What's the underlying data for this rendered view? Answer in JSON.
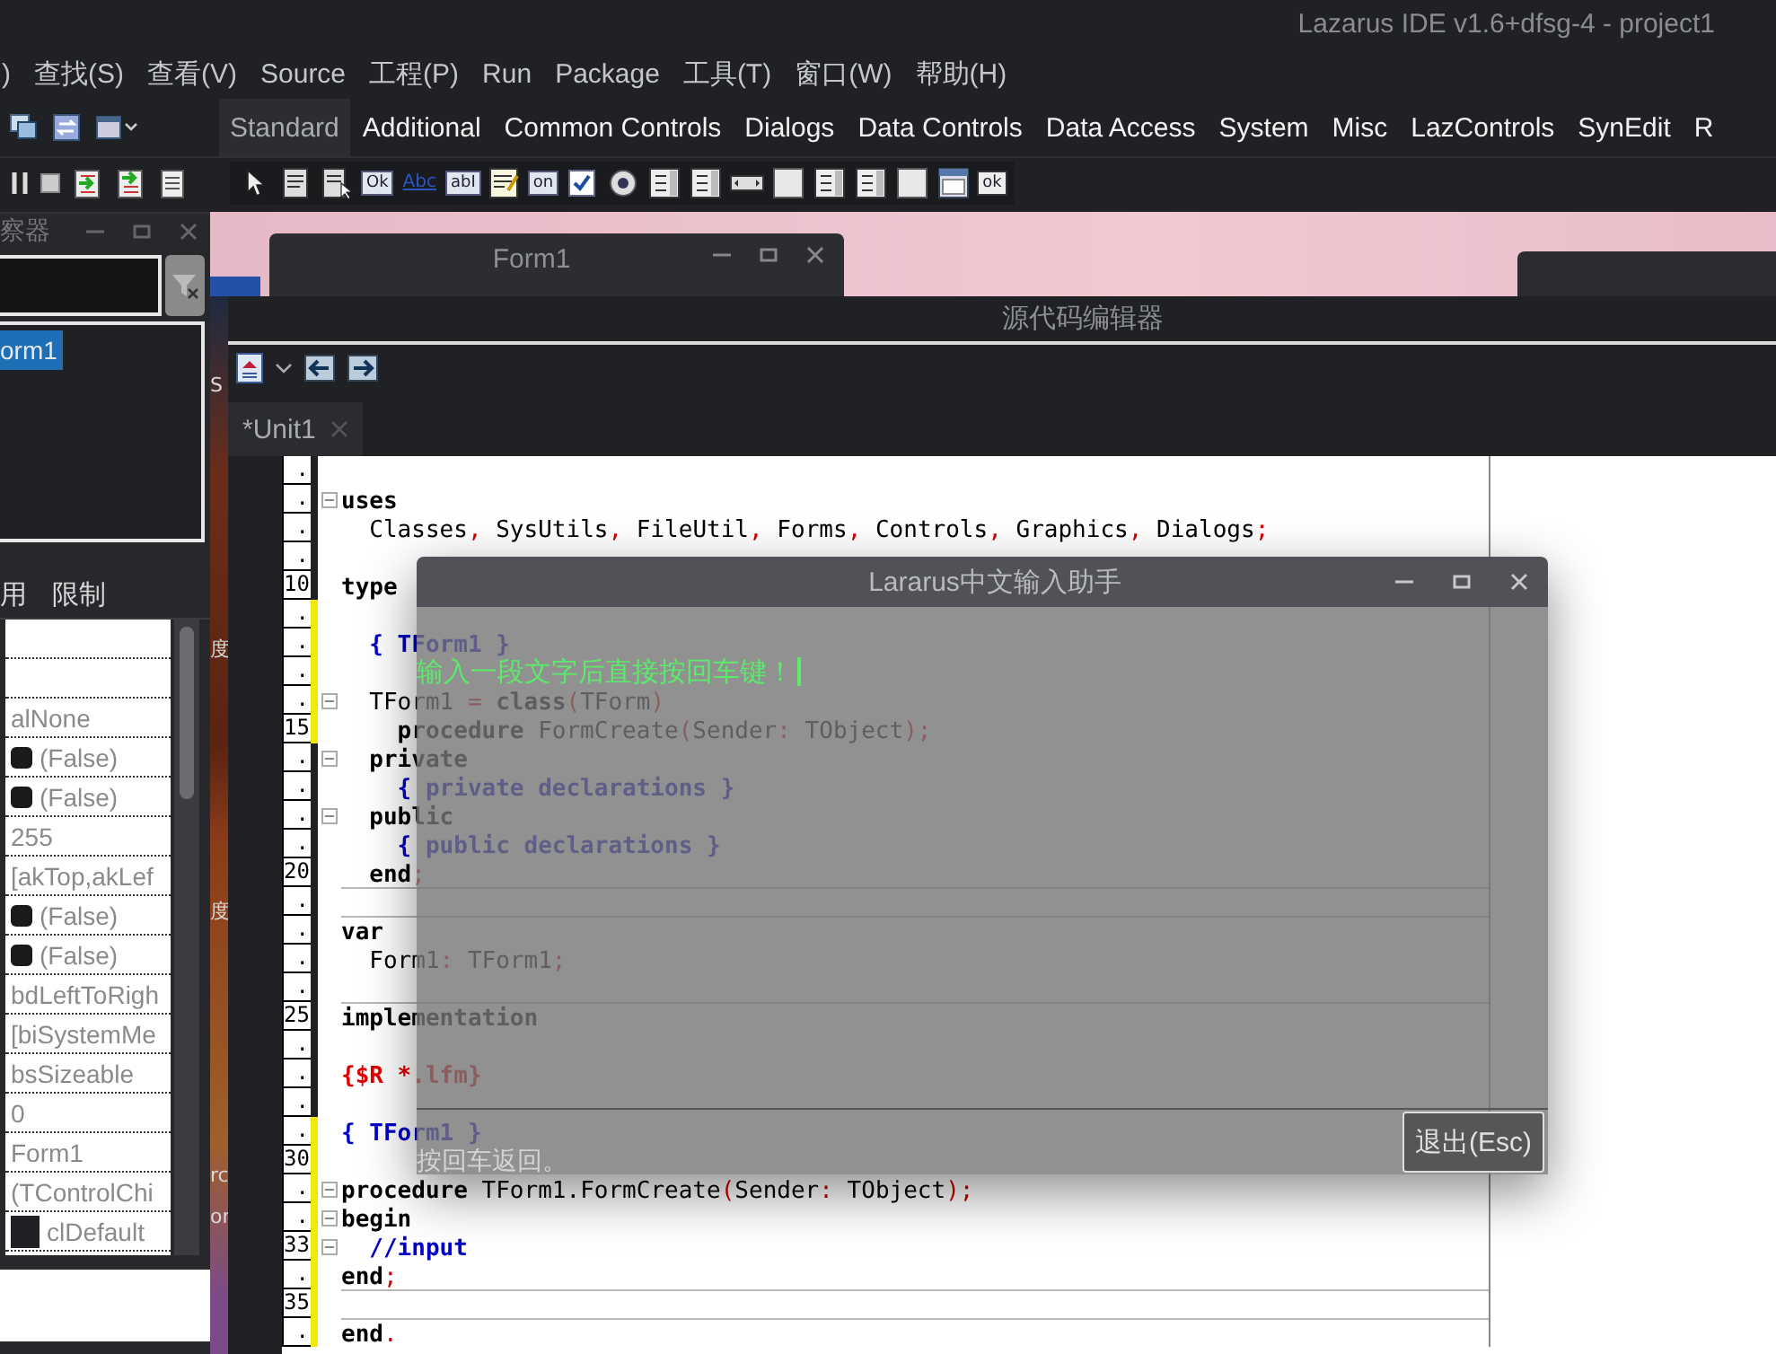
{
  "main_window": {
    "title": "Lazarus IDE v1.6+dfsg-4 - project1",
    "menu": [
      ")",
      "查找(S)",
      "查看(V)",
      "Source",
      "工程(P)",
      "Run",
      "Package",
      "工具(T)",
      "窗口(W)",
      "帮助(H)"
    ],
    "palette_tabs": [
      {
        "label": "Standard",
        "selected": true
      },
      {
        "label": "Additional",
        "selected": false
      },
      {
        "label": "Common Controls",
        "selected": false
      },
      {
        "label": "Dialogs",
        "selected": false
      },
      {
        "label": "Data Controls",
        "selected": false
      },
      {
        "label": "Data Access",
        "selected": false
      },
      {
        "label": "System",
        "selected": false
      },
      {
        "label": "Misc",
        "selected": false
      },
      {
        "label": "LazControls",
        "selected": false
      },
      {
        "label": "SynEdit",
        "selected": false
      },
      {
        "label": "R",
        "selected": false
      }
    ],
    "components": [
      {
        "kind": "pointer"
      },
      {
        "kind": "menu"
      },
      {
        "kind": "popup"
      },
      {
        "kind": "captioned",
        "caption": "Ok"
      },
      {
        "kind": "label",
        "caption": "Abc"
      },
      {
        "kind": "captioned",
        "caption": "abI"
      },
      {
        "kind": "memo"
      },
      {
        "kind": "captioned",
        "caption": "on"
      },
      {
        "kind": "check"
      },
      {
        "kind": "radio"
      },
      {
        "kind": "list"
      },
      {
        "kind": "list"
      },
      {
        "kind": "scroll"
      },
      {
        "kind": "panel"
      },
      {
        "kind": "list"
      },
      {
        "kind": "list"
      },
      {
        "kind": "panel"
      },
      {
        "kind": "frame"
      },
      {
        "kind": "action",
        "caption": "ok"
      }
    ]
  },
  "inspector": {
    "title": "察器",
    "tree": [
      {
        "label": "orm1",
        "selected": true
      }
    ],
    "tabs": [
      "用",
      "限制"
    ],
    "values": [
      {
        "kind": "blank"
      },
      {
        "kind": "blank"
      },
      {
        "kind": "text",
        "text": "alNone"
      },
      {
        "kind": "bool",
        "checked": false,
        "text": "(False)"
      },
      {
        "kind": "bool",
        "checked": false,
        "text": "(False)"
      },
      {
        "kind": "text",
        "text": "255"
      },
      {
        "kind": "text",
        "text": "[akTop,akLef"
      },
      {
        "kind": "bool",
        "checked": false,
        "text": "(False)"
      },
      {
        "kind": "bool",
        "checked": false,
        "text": "(False)"
      },
      {
        "kind": "text",
        "text": "bdLeftToRigh"
      },
      {
        "kind": "text",
        "text": "[biSystemMe"
      },
      {
        "kind": "text",
        "text": "bsSizeable"
      },
      {
        "kind": "text",
        "text": "0"
      },
      {
        "kind": "text",
        "text": "Form1"
      },
      {
        "kind": "text",
        "text": "(TControlChi"
      },
      {
        "kind": "color",
        "color": "#1e2024",
        "text": "clDefault"
      }
    ]
  },
  "background_fragments": [
    "S",
    "度",
    "度",
    "rc",
    "or"
  ],
  "form_window": {
    "title": "Form1"
  },
  "editor": {
    "title": "源代码编辑器",
    "tabs": [
      {
        "label": "*Unit1",
        "selected": true
      }
    ],
    "lines": [
      {
        "gutter": ".",
        "modified": false,
        "fold": false,
        "divider": false
      },
      {
        "gutter": ".",
        "modified": false,
        "fold": true,
        "divider": false,
        "tokens": [
          {
            "kind": "kw",
            "text": "uses"
          }
        ]
      },
      {
        "gutter": ".",
        "modified": false,
        "fold": false,
        "divider": false,
        "tokens": [
          {
            "kind": "id",
            "text": "  Classes"
          },
          {
            "kind": "sym",
            "text": ","
          },
          {
            "kind": "id",
            "text": " SysUtils"
          },
          {
            "kind": "sym",
            "text": ","
          },
          {
            "kind": "id",
            "text": " FileUtil"
          },
          {
            "kind": "sym",
            "text": ","
          },
          {
            "kind": "id",
            "text": " Forms"
          },
          {
            "kind": "sym",
            "text": ","
          },
          {
            "kind": "id",
            "text": " Controls"
          },
          {
            "kind": "sym",
            "text": ","
          },
          {
            "kind": "id",
            "text": " Graphics"
          },
          {
            "kind": "sym",
            "text": ","
          },
          {
            "kind": "id",
            "text": " Dialogs"
          },
          {
            "kind": "sym",
            "text": ";"
          }
        ]
      },
      {
        "gutter": ".",
        "modified": false,
        "fold": false,
        "divider": false
      },
      {
        "gutter": "10",
        "modified": false,
        "fold": false,
        "divider": false,
        "tokens": [
          {
            "kind": "kw",
            "text": "type"
          }
        ]
      },
      {
        "gutter": ".",
        "modified": true,
        "fold": false,
        "divider": false
      },
      {
        "gutter": ".",
        "modified": true,
        "fold": false,
        "divider": false,
        "tokens": [
          {
            "kind": "cm",
            "text": "  { TForm1 }"
          }
        ]
      },
      {
        "gutter": ".",
        "modified": true,
        "fold": false,
        "divider": false
      },
      {
        "gutter": ".",
        "modified": true,
        "fold": true,
        "divider": false,
        "tokens": [
          {
            "kind": "id",
            "text": "  TForm1 "
          },
          {
            "kind": "sym",
            "text": "="
          },
          {
            "kind": "kw",
            "text": " class"
          },
          {
            "kind": "sym",
            "text": "("
          },
          {
            "kind": "id",
            "text": "TForm"
          },
          {
            "kind": "sym",
            "text": ")"
          }
        ]
      },
      {
        "gutter": "15",
        "modified": true,
        "fold": false,
        "divider": false,
        "tokens": [
          {
            "kind": "kw",
            "text": "    procedure"
          },
          {
            "kind": "id",
            "text": " FormCreate"
          },
          {
            "kind": "sym",
            "text": "("
          },
          {
            "kind": "id",
            "text": "Sender"
          },
          {
            "kind": "sym",
            "text": ":"
          },
          {
            "kind": "id",
            "text": " TObject"
          },
          {
            "kind": "sym",
            "text": ");"
          }
        ]
      },
      {
        "gutter": ".",
        "modified": false,
        "fold": true,
        "divider": false,
        "tokens": [
          {
            "kind": "kw",
            "text": "  private"
          }
        ]
      },
      {
        "gutter": ".",
        "modified": false,
        "fold": false,
        "divider": false,
        "tokens": [
          {
            "kind": "cm",
            "text": "    { private declarations }"
          }
        ]
      },
      {
        "gutter": ".",
        "modified": false,
        "fold": true,
        "divider": false,
        "tokens": [
          {
            "kind": "kw",
            "text": "  public"
          }
        ]
      },
      {
        "gutter": ".",
        "modified": false,
        "fold": false,
        "divider": false,
        "tokens": [
          {
            "kind": "cm",
            "text": "    { public declarations }"
          }
        ]
      },
      {
        "gutter": "20",
        "modified": false,
        "fold": false,
        "divider": false,
        "tokens": [
          {
            "kind": "kw",
            "text": "  end"
          },
          {
            "kind": "sym",
            "text": ";"
          }
        ]
      },
      {
        "gutter": ".",
        "modified": false,
        "fold": false,
        "divider": true
      },
      {
        "gutter": ".",
        "modified": false,
        "fold": false,
        "divider": true,
        "tokens": [
          {
            "kind": "kw",
            "text": "var"
          }
        ]
      },
      {
        "gutter": ".",
        "modified": false,
        "fold": false,
        "divider": false,
        "tokens": [
          {
            "kind": "id",
            "text": "  Form1"
          },
          {
            "kind": "sym",
            "text": ":"
          },
          {
            "kind": "id",
            "text": " TForm1"
          },
          {
            "kind": "sym",
            "text": ";"
          }
        ]
      },
      {
        "gutter": ".",
        "modified": false,
        "fold": false,
        "divider": false
      },
      {
        "gutter": "25",
        "modified": false,
        "fold": false,
        "divider": true,
        "tokens": [
          {
            "kind": "kw",
            "text": "implementation"
          }
        ]
      },
      {
        "gutter": ".",
        "modified": false,
        "fold": false,
        "divider": false
      },
      {
        "gutter": ".",
        "modified": false,
        "fold": false,
        "divider": false,
        "tokens": [
          {
            "kind": "dir",
            "text": "{$R *.lfm}"
          }
        ]
      },
      {
        "gutter": ".",
        "modified": false,
        "fold": false,
        "divider": false
      },
      {
        "gutter": ".",
        "modified": true,
        "fold": false,
        "divider": false,
        "tokens": [
          {
            "kind": "cm",
            "text": "{ TForm1 }"
          }
        ]
      },
      {
        "gutter": "30",
        "modified": true,
        "fold": false,
        "divider": false
      },
      {
        "gutter": ".",
        "modified": true,
        "fold": true,
        "divider": false,
        "tokens": [
          {
            "kind": "kw",
            "text": "procedure"
          },
          {
            "kind": "id",
            "text": " TForm1.FormCreate"
          },
          {
            "kind": "sym",
            "text": "("
          },
          {
            "kind": "id",
            "text": "Sender"
          },
          {
            "kind": "sym",
            "text": ":"
          },
          {
            "kind": "id",
            "text": " TObject"
          },
          {
            "kind": "sym",
            "text": ");"
          }
        ]
      },
      {
        "gutter": ".",
        "modified": true,
        "fold": true,
        "divider": false,
        "tokens": [
          {
            "kind": "kw",
            "text": "begin"
          }
        ]
      },
      {
        "gutter": "33",
        "modified": true,
        "fold": true,
        "divider": false,
        "tokens": [
          {
            "kind": "cm",
            "text": "  //input"
          }
        ]
      },
      {
        "gutter": ".",
        "modified": true,
        "fold": false,
        "divider": false,
        "tokens": [
          {
            "kind": "kw",
            "text": "end"
          },
          {
            "kind": "sym",
            "text": ";"
          }
        ]
      },
      {
        "gutter": "35",
        "modified": true,
        "fold": false,
        "divider": true
      },
      {
        "gutter": ".",
        "modified": true,
        "fold": false,
        "divider": true,
        "tokens": [
          {
            "kind": "kw",
            "text": "end"
          },
          {
            "kind": "sym",
            "text": "."
          }
        ]
      }
    ]
  },
  "dialog": {
    "title": "Lararus中文输入助手",
    "input": {
      "value": "输入一段文字后直接按回车键！"
    },
    "hint": "按回车返回。",
    "buttons": [
      "退出(Esc)"
    ]
  }
}
